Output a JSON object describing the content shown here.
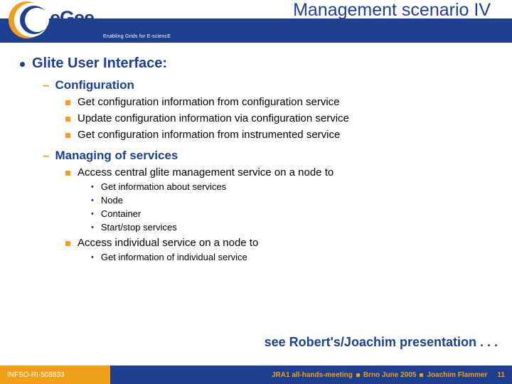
{
  "header": {
    "title": "Management scenario IV",
    "tagline": "Enabling Grids for E-sciencE",
    "logo_text": "egee"
  },
  "content": {
    "main_topic": "Glite User Interface:",
    "sections": [
      {
        "label": "Configuration",
        "items": [
          {
            "text": "Get configuration information from configuration service"
          },
          {
            "text": "Update configuration information via configuration service"
          },
          {
            "text": "Get configuration information from instrumented service"
          }
        ]
      },
      {
        "label": "Managing of services",
        "items": [
          {
            "text": "Access central glite management service on a node to",
            "subitems": [
              "Get information about services",
              "Node",
              "Container",
              "Start/stop services"
            ]
          },
          {
            "text": "Access individual service on a node to",
            "subitems": [
              "Get information of individual service"
            ]
          }
        ]
      }
    ],
    "closing": "see Robert's/Joachim presentation . . ."
  },
  "footer": {
    "ref": "INFSO-RI-508833",
    "meeting": "JRA1 all-hands-meeting",
    "location": "Brno June 2005",
    "author": "Joachim Flammer",
    "page": "11"
  }
}
